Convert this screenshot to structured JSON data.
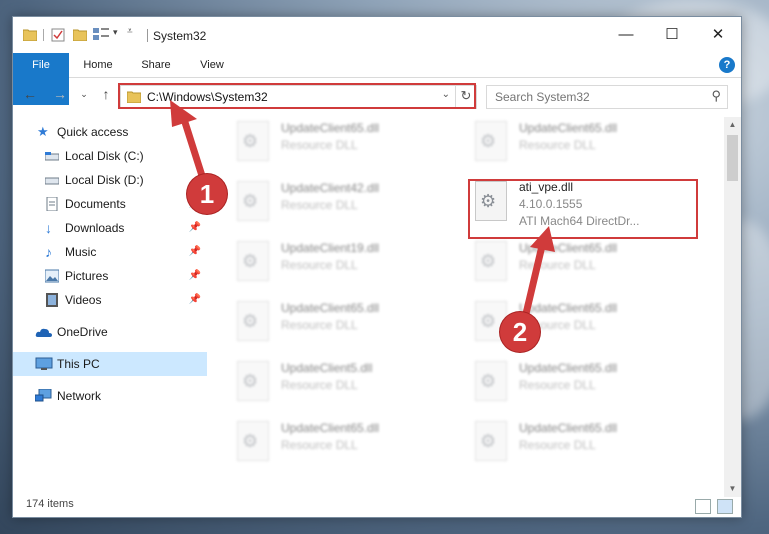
{
  "window": {
    "title": "System32",
    "controls": {
      "minimize": "—",
      "maximize": "☐",
      "close": "✕"
    }
  },
  "ribbon": {
    "tabs": [
      {
        "label": "File"
      },
      {
        "label": "Home"
      },
      {
        "label": "Share"
      },
      {
        "label": "View"
      }
    ],
    "help": "?"
  },
  "nav": {
    "address_path": "C:\\Windows\\System32",
    "search_placeholder": "Search System32"
  },
  "sidebar": {
    "items": [
      {
        "label": "Quick access",
        "icon": "star-icon",
        "pinned": false
      },
      {
        "label": "Local Disk (C:)",
        "icon": "drive-icon",
        "pinned": false
      },
      {
        "label": "Local Disk (D:)",
        "icon": "drive-icon",
        "pinned": false
      },
      {
        "label": "Documents",
        "icon": "document-icon",
        "pinned": true
      },
      {
        "label": "Downloads",
        "icon": "download-icon",
        "pinned": true
      },
      {
        "label": "Music",
        "icon": "music-icon",
        "pinned": true
      },
      {
        "label": "Pictures",
        "icon": "pictures-icon",
        "pinned": true
      },
      {
        "label": "Videos",
        "icon": "videos-icon",
        "pinned": true
      },
      {
        "label": "OneDrive",
        "icon": "cloud-icon",
        "pinned": false
      },
      {
        "label": "This PC",
        "icon": "computer-icon",
        "pinned": false
      },
      {
        "label": "Network",
        "icon": "network-icon",
        "pinned": false
      }
    ]
  },
  "files": {
    "left": [
      {
        "name": "UpdateClient65.dll",
        "desc": "Resource DLL"
      },
      {
        "name": "UpdateClient42.dll",
        "desc": "Resource DLL"
      },
      {
        "name": "UpdateClient19.dll",
        "desc": "Resource DLL"
      },
      {
        "name": "UpdateClient65.dll",
        "desc": "Resource DLL"
      },
      {
        "name": "UpdateClient5.dll",
        "desc": "Resource DLL"
      },
      {
        "name": "UpdateClient65.dll",
        "desc": "Resource DLL"
      }
    ],
    "right": [
      {
        "name": "UpdateClient65.dll",
        "desc": "Resource DLL"
      },
      {
        "name": "ati_vpe.dll",
        "version": "4.10.0.1555",
        "desc": "ATI Mach64 DirectDr..."
      },
      {
        "name": "UpdateClient65.dll",
        "desc": "Resource DLL"
      },
      {
        "name": "UpdateClient65.dll",
        "desc": "Resource DLL"
      },
      {
        "name": "UpdateClient65.dll",
        "desc": "Resource DLL"
      },
      {
        "name": "UpdateClient65.dll",
        "desc": "Resource DLL"
      }
    ]
  },
  "status": {
    "item_count": "174 items"
  },
  "callouts": [
    {
      "number": "1"
    },
    {
      "number": "2"
    }
  ],
  "colors": {
    "accent": "#1979ca",
    "highlight": "#d03b3b",
    "selected": "#cce8ff"
  }
}
